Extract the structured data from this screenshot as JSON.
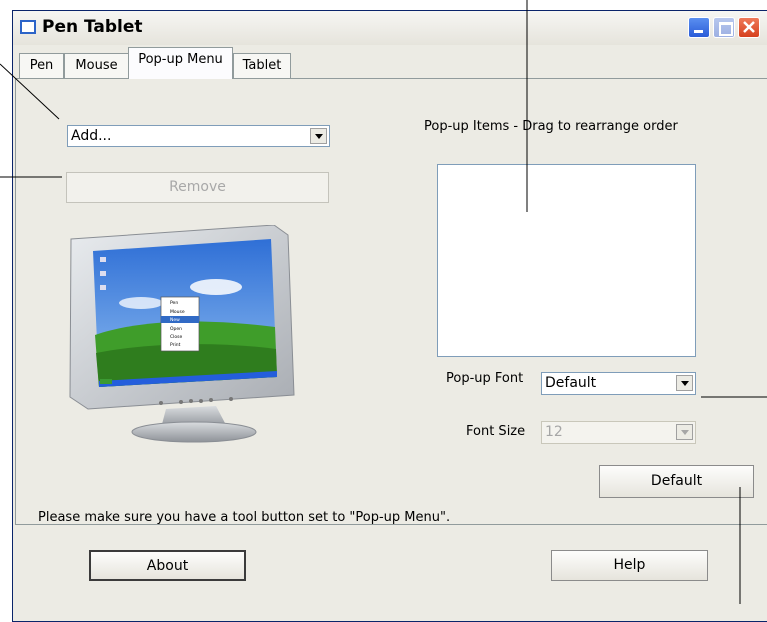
{
  "window": {
    "title": "Pen Tablet"
  },
  "tabs": [
    {
      "label": "Pen"
    },
    {
      "label": "Mouse"
    },
    {
      "label": "Pop-up Menu"
    },
    {
      "label": "Tablet"
    }
  ],
  "popup_menu": {
    "add_combo": {
      "value": "Add..."
    },
    "remove_button": {
      "label": "Remove"
    },
    "items_header": "Pop-up Items - Drag to rearrange order",
    "font_label": "Pop-up Font",
    "font_value": "Default",
    "font_size_label": "Font Size",
    "font_size_value": "12",
    "default_button": "Default",
    "note": "Please make sure you have a tool button set to \"Pop-up Menu\".",
    "preview_menu_items": [
      "Pen",
      "Mouse",
      "New",
      "Open",
      "Close",
      "Print"
    ]
  },
  "footer": {
    "about_button": "About",
    "help_button": "Help"
  }
}
